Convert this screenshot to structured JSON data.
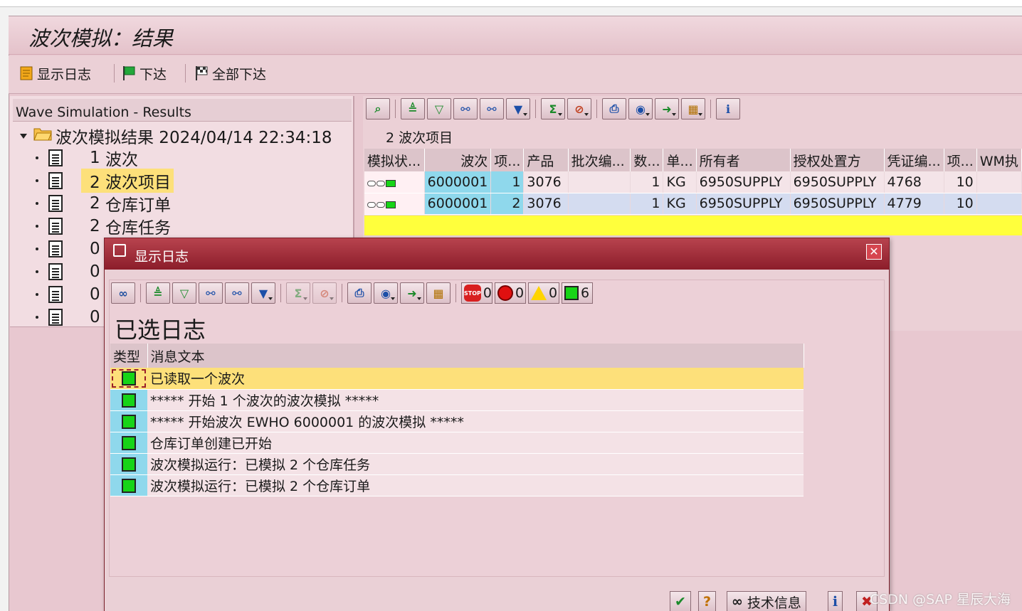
{
  "window_title": "波次模拟：结果",
  "app_toolbar": {
    "show_log": "显示日志",
    "release": "下达",
    "release_all": "全部下达"
  },
  "tree": {
    "header": "Wave Simulation - Results",
    "root_label": "波次模拟结果 2024/04/14 22:34:18",
    "items": [
      {
        "count": "1",
        "label": "波次"
      },
      {
        "count": "2",
        "label": "波次项目"
      },
      {
        "count": "2",
        "label": "仓库订单"
      },
      {
        "count": "2",
        "label": "仓库任务"
      },
      {
        "count": "0",
        "label": ""
      },
      {
        "count": "0",
        "label": ""
      },
      {
        "count": "0",
        "label": ""
      },
      {
        "count": "0",
        "label": ""
      }
    ]
  },
  "grid": {
    "caption": "2 波次项目",
    "columns": [
      "模拟状...",
      "波次",
      "项...",
      "产品",
      "批次编...",
      "数...",
      "单...",
      "所有者",
      "授权处置方",
      "凭证编...",
      "项...",
      "WM执"
    ],
    "rows": [
      {
        "wave": "6000001",
        "item": "1",
        "product": "3076",
        "batch": "",
        "qty": "1",
        "unit": "KG",
        "owner": "6950SUPPLY",
        "disposer": "6950SUPPLY",
        "doc": "4768",
        "docitem": "10"
      },
      {
        "wave": "6000001",
        "item": "2",
        "product": "3076",
        "batch": "",
        "qty": "1",
        "unit": "KG",
        "owner": "6950SUPPLY",
        "disposer": "6950SUPPLY",
        "doc": "4779",
        "docitem": "10"
      }
    ]
  },
  "dialog": {
    "title": "显示日志",
    "heading": "已选日志",
    "counts": {
      "stop": "0",
      "error": "0",
      "warning": "0",
      "success": "6"
    },
    "columns": {
      "type": "类型",
      "message": "消息文本"
    },
    "messages": [
      "已读取一个波次",
      "***** 开始 1 个波次的波次模拟 *****",
      "***** 开始波次 EWHO 6000001 的波次模拟 *****",
      "仓库订单创建已开始",
      "波次模拟运行：已模拟 2 个仓库任务",
      "波次模拟运行：已模拟 2 个仓库订单"
    ],
    "footer_tech_info": "技术信息"
  },
  "watermark": "CSDN @SAP 星辰大海",
  "colors": {
    "frame": "#e8c8d0",
    "dialog_title": "#8c1d2a",
    "selection": "#fde07a",
    "key_cell": "#8fd8ec",
    "success": "#17d417"
  }
}
